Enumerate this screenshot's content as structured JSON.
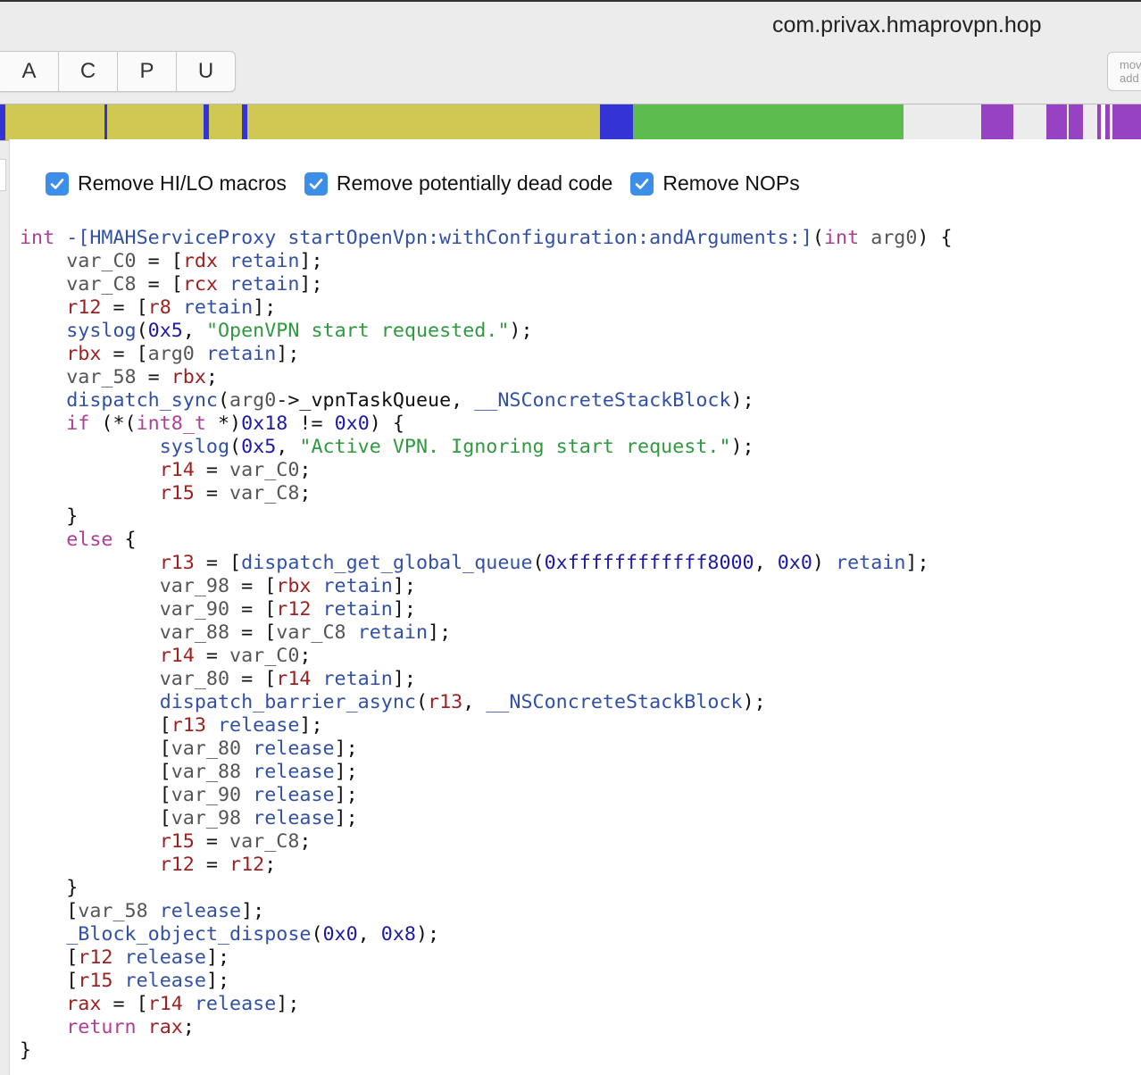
{
  "window": {
    "title": "com.privax.hmaprovpn.hop"
  },
  "toolbar": {
    "segments": [
      {
        "label": "A"
      },
      {
        "label": "C"
      },
      {
        "label": "P"
      },
      {
        "label": "U"
      }
    ],
    "mode_lines": [
      "mov",
      "add"
    ]
  },
  "navbar": {
    "colors": {
      "code": "#cfc853",
      "proc": "#3434d6",
      "data": "#5cbd4e",
      "empty": "#ececec",
      "external": "#9741c3",
      "white": "#ffffff"
    },
    "segments": [
      {
        "kind": "proc",
        "share": 0.5
      },
      {
        "kind": "code",
        "share": 8.6
      },
      {
        "kind": "proc",
        "share": 0.3
      },
      {
        "kind": "code",
        "share": 8.4
      },
      {
        "kind": "proc",
        "share": 0.5
      },
      {
        "kind": "code",
        "share": 2.9
      },
      {
        "kind": "proc",
        "share": 0.4
      },
      {
        "kind": "code",
        "share": 30.9
      },
      {
        "kind": "proc",
        "share": 2.9
      },
      {
        "kind": "data",
        "share": 23.6
      },
      {
        "kind": "empty",
        "share": 6.8
      },
      {
        "kind": "external",
        "share": 2.8
      },
      {
        "kind": "empty",
        "share": 2.9
      },
      {
        "kind": "external",
        "share": 1.8
      },
      {
        "kind": "white",
        "share": 0.2
      },
      {
        "kind": "external",
        "share": 1.2
      },
      {
        "kind": "empty",
        "share": 1.3
      },
      {
        "kind": "external",
        "share": 0.3
      },
      {
        "kind": "white",
        "share": 0.4
      },
      {
        "kind": "external",
        "share": 0.4
      },
      {
        "kind": "white",
        "share": 0.2
      },
      {
        "kind": "external",
        "share": 2.5
      }
    ]
  },
  "options": [
    {
      "label": "Remove HI/LO macros",
      "checked": true
    },
    {
      "label": "Remove potentially dead code",
      "checked": true
    },
    {
      "label": "Remove NOPs",
      "checked": true
    }
  ],
  "code": {
    "lines": [
      [
        [
          "kw",
          "int"
        ],
        [
          "p",
          " "
        ],
        [
          "fn",
          "-[HMAHServiceProxy startOpenVpn:withConfiguration:andArguments:]"
        ],
        [
          "p",
          "("
        ],
        [
          "kw",
          "int"
        ],
        [
          "p",
          " "
        ],
        [
          "v",
          "arg0"
        ],
        [
          "p",
          ") {"
        ]
      ],
      [
        [
          "p",
          "    "
        ],
        [
          "v",
          "var_C0"
        ],
        [
          "p",
          " = ["
        ],
        [
          "reg",
          "rdx"
        ],
        [
          "p",
          " "
        ],
        [
          "fn",
          "retain"
        ],
        [
          "p",
          "];"
        ]
      ],
      [
        [
          "p",
          "    "
        ],
        [
          "v",
          "var_C8"
        ],
        [
          "p",
          " = ["
        ],
        [
          "reg",
          "rcx"
        ],
        [
          "p",
          " "
        ],
        [
          "fn",
          "retain"
        ],
        [
          "p",
          "];"
        ]
      ],
      [
        [
          "p",
          "    "
        ],
        [
          "reg",
          "r12"
        ],
        [
          "p",
          " = ["
        ],
        [
          "reg",
          "r8"
        ],
        [
          "p",
          " "
        ],
        [
          "fn",
          "retain"
        ],
        [
          "p",
          "];"
        ]
      ],
      [
        [
          "p",
          "    "
        ],
        [
          "fn",
          "syslog"
        ],
        [
          "p",
          "("
        ],
        [
          "num",
          "0x5"
        ],
        [
          "p",
          ", "
        ],
        [
          "str",
          "\"OpenVPN start requested.\""
        ],
        [
          "p",
          ");"
        ]
      ],
      [
        [
          "p",
          "    "
        ],
        [
          "reg",
          "rbx"
        ],
        [
          "p",
          " = ["
        ],
        [
          "v",
          "arg0"
        ],
        [
          "p",
          " "
        ],
        [
          "fn",
          "retain"
        ],
        [
          "p",
          "];"
        ]
      ],
      [
        [
          "p",
          "    "
        ],
        [
          "v",
          "var_58"
        ],
        [
          "p",
          " = "
        ],
        [
          "reg",
          "rbx"
        ],
        [
          "p",
          ";"
        ]
      ],
      [
        [
          "p",
          "    "
        ],
        [
          "fn",
          "dispatch_sync"
        ],
        [
          "p",
          "("
        ],
        [
          "v",
          "arg0"
        ],
        [
          "p",
          "->_vpnTaskQueue, "
        ],
        [
          "fn",
          "__NSConcreteStackBlock"
        ],
        [
          "p",
          ");"
        ]
      ],
      [
        [
          "p",
          "    "
        ],
        [
          "kw",
          "if"
        ],
        [
          "p",
          " (*("
        ],
        [
          "kw",
          "int8_t"
        ],
        [
          "p",
          " *)"
        ],
        [
          "num",
          "0x18"
        ],
        [
          "p",
          " != "
        ],
        [
          "num",
          "0x0"
        ],
        [
          "p",
          ") {"
        ]
      ],
      [
        [
          "p",
          "            "
        ],
        [
          "fn",
          "syslog"
        ],
        [
          "p",
          "("
        ],
        [
          "num",
          "0x5"
        ],
        [
          "p",
          ", "
        ],
        [
          "str",
          "\"Active VPN. Ignoring start request.\""
        ],
        [
          "p",
          ");"
        ]
      ],
      [
        [
          "p",
          "            "
        ],
        [
          "reg",
          "r14"
        ],
        [
          "p",
          " = "
        ],
        [
          "v",
          "var_C0"
        ],
        [
          "p",
          ";"
        ]
      ],
      [
        [
          "p",
          "            "
        ],
        [
          "reg",
          "r15"
        ],
        [
          "p",
          " = "
        ],
        [
          "v",
          "var_C8"
        ],
        [
          "p",
          ";"
        ]
      ],
      [
        [
          "p",
          "    }"
        ]
      ],
      [
        [
          "p",
          "    "
        ],
        [
          "kw",
          "else"
        ],
        [
          "p",
          " {"
        ]
      ],
      [
        [
          "p",
          "            "
        ],
        [
          "reg",
          "r13"
        ],
        [
          "p",
          " = ["
        ],
        [
          "fn",
          "dispatch_get_global_queue"
        ],
        [
          "p",
          "("
        ],
        [
          "num",
          "0xffffffffffff8000"
        ],
        [
          "p",
          ", "
        ],
        [
          "num",
          "0x0"
        ],
        [
          "p",
          ") "
        ],
        [
          "fn",
          "retain"
        ],
        [
          "p",
          "];"
        ]
      ],
      [
        [
          "p",
          "            "
        ],
        [
          "v",
          "var_98"
        ],
        [
          "p",
          " = ["
        ],
        [
          "reg",
          "rbx"
        ],
        [
          "p",
          " "
        ],
        [
          "fn",
          "retain"
        ],
        [
          "p",
          "];"
        ]
      ],
      [
        [
          "p",
          "            "
        ],
        [
          "v",
          "var_90"
        ],
        [
          "p",
          " = ["
        ],
        [
          "reg",
          "r12"
        ],
        [
          "p",
          " "
        ],
        [
          "fn",
          "retain"
        ],
        [
          "p",
          "];"
        ]
      ],
      [
        [
          "p",
          "            "
        ],
        [
          "v",
          "var_88"
        ],
        [
          "p",
          " = ["
        ],
        [
          "v",
          "var_C8"
        ],
        [
          "p",
          " "
        ],
        [
          "fn",
          "retain"
        ],
        [
          "p",
          "];"
        ]
      ],
      [
        [
          "p",
          "            "
        ],
        [
          "reg",
          "r14"
        ],
        [
          "p",
          " = "
        ],
        [
          "v",
          "var_C0"
        ],
        [
          "p",
          ";"
        ]
      ],
      [
        [
          "p",
          "            "
        ],
        [
          "v",
          "var_80"
        ],
        [
          "p",
          " = ["
        ],
        [
          "reg",
          "r14"
        ],
        [
          "p",
          " "
        ],
        [
          "fn",
          "retain"
        ],
        [
          "p",
          "];"
        ]
      ],
      [
        [
          "p",
          "            "
        ],
        [
          "fn",
          "dispatch_barrier_async"
        ],
        [
          "p",
          "("
        ],
        [
          "reg",
          "r13"
        ],
        [
          "p",
          ", "
        ],
        [
          "fn",
          "__NSConcreteStackBlock"
        ],
        [
          "p",
          ");"
        ]
      ],
      [
        [
          "p",
          "            ["
        ],
        [
          "reg",
          "r13"
        ],
        [
          "p",
          " "
        ],
        [
          "fn",
          "release"
        ],
        [
          "p",
          "];"
        ]
      ],
      [
        [
          "p",
          "            ["
        ],
        [
          "v",
          "var_80"
        ],
        [
          "p",
          " "
        ],
        [
          "fn",
          "release"
        ],
        [
          "p",
          "];"
        ]
      ],
      [
        [
          "p",
          "            ["
        ],
        [
          "v",
          "var_88"
        ],
        [
          "p",
          " "
        ],
        [
          "fn",
          "release"
        ],
        [
          "p",
          "];"
        ]
      ],
      [
        [
          "p",
          "            ["
        ],
        [
          "v",
          "var_90"
        ],
        [
          "p",
          " "
        ],
        [
          "fn",
          "release"
        ],
        [
          "p",
          "];"
        ]
      ],
      [
        [
          "p",
          "            ["
        ],
        [
          "v",
          "var_98"
        ],
        [
          "p",
          " "
        ],
        [
          "fn",
          "release"
        ],
        [
          "p",
          "];"
        ]
      ],
      [
        [
          "p",
          "            "
        ],
        [
          "reg",
          "r15"
        ],
        [
          "p",
          " = "
        ],
        [
          "v",
          "var_C8"
        ],
        [
          "p",
          ";"
        ]
      ],
      [
        [
          "p",
          "            "
        ],
        [
          "reg",
          "r12"
        ],
        [
          "p",
          " = "
        ],
        [
          "reg",
          "r12"
        ],
        [
          "p",
          ";"
        ]
      ],
      [
        [
          "p",
          "    }"
        ]
      ],
      [
        [
          "p",
          "    ["
        ],
        [
          "v",
          "var_58"
        ],
        [
          "p",
          " "
        ],
        [
          "fn",
          "release"
        ],
        [
          "p",
          "];"
        ]
      ],
      [
        [
          "p",
          "    "
        ],
        [
          "fn",
          "_Block_object_dispose"
        ],
        [
          "p",
          "("
        ],
        [
          "num",
          "0x0"
        ],
        [
          "p",
          ", "
        ],
        [
          "num",
          "0x8"
        ],
        [
          "p",
          ");"
        ]
      ],
      [
        [
          "p",
          "    ["
        ],
        [
          "reg",
          "r12"
        ],
        [
          "p",
          " "
        ],
        [
          "fn",
          "release"
        ],
        [
          "p",
          "];"
        ]
      ],
      [
        [
          "p",
          "    ["
        ],
        [
          "reg",
          "r15"
        ],
        [
          "p",
          " "
        ],
        [
          "fn",
          "release"
        ],
        [
          "p",
          "];"
        ]
      ],
      [
        [
          "p",
          "    "
        ],
        [
          "reg",
          "rax"
        ],
        [
          "p",
          " = ["
        ],
        [
          "reg",
          "r14"
        ],
        [
          "p",
          " "
        ],
        [
          "fn",
          "release"
        ],
        [
          "p",
          "];"
        ]
      ],
      [
        [
          "p",
          "    "
        ],
        [
          "kw",
          "return"
        ],
        [
          "p",
          " "
        ],
        [
          "reg",
          "rax"
        ],
        [
          "p",
          ";"
        ]
      ],
      [
        [
          "p",
          "}"
        ]
      ]
    ]
  }
}
